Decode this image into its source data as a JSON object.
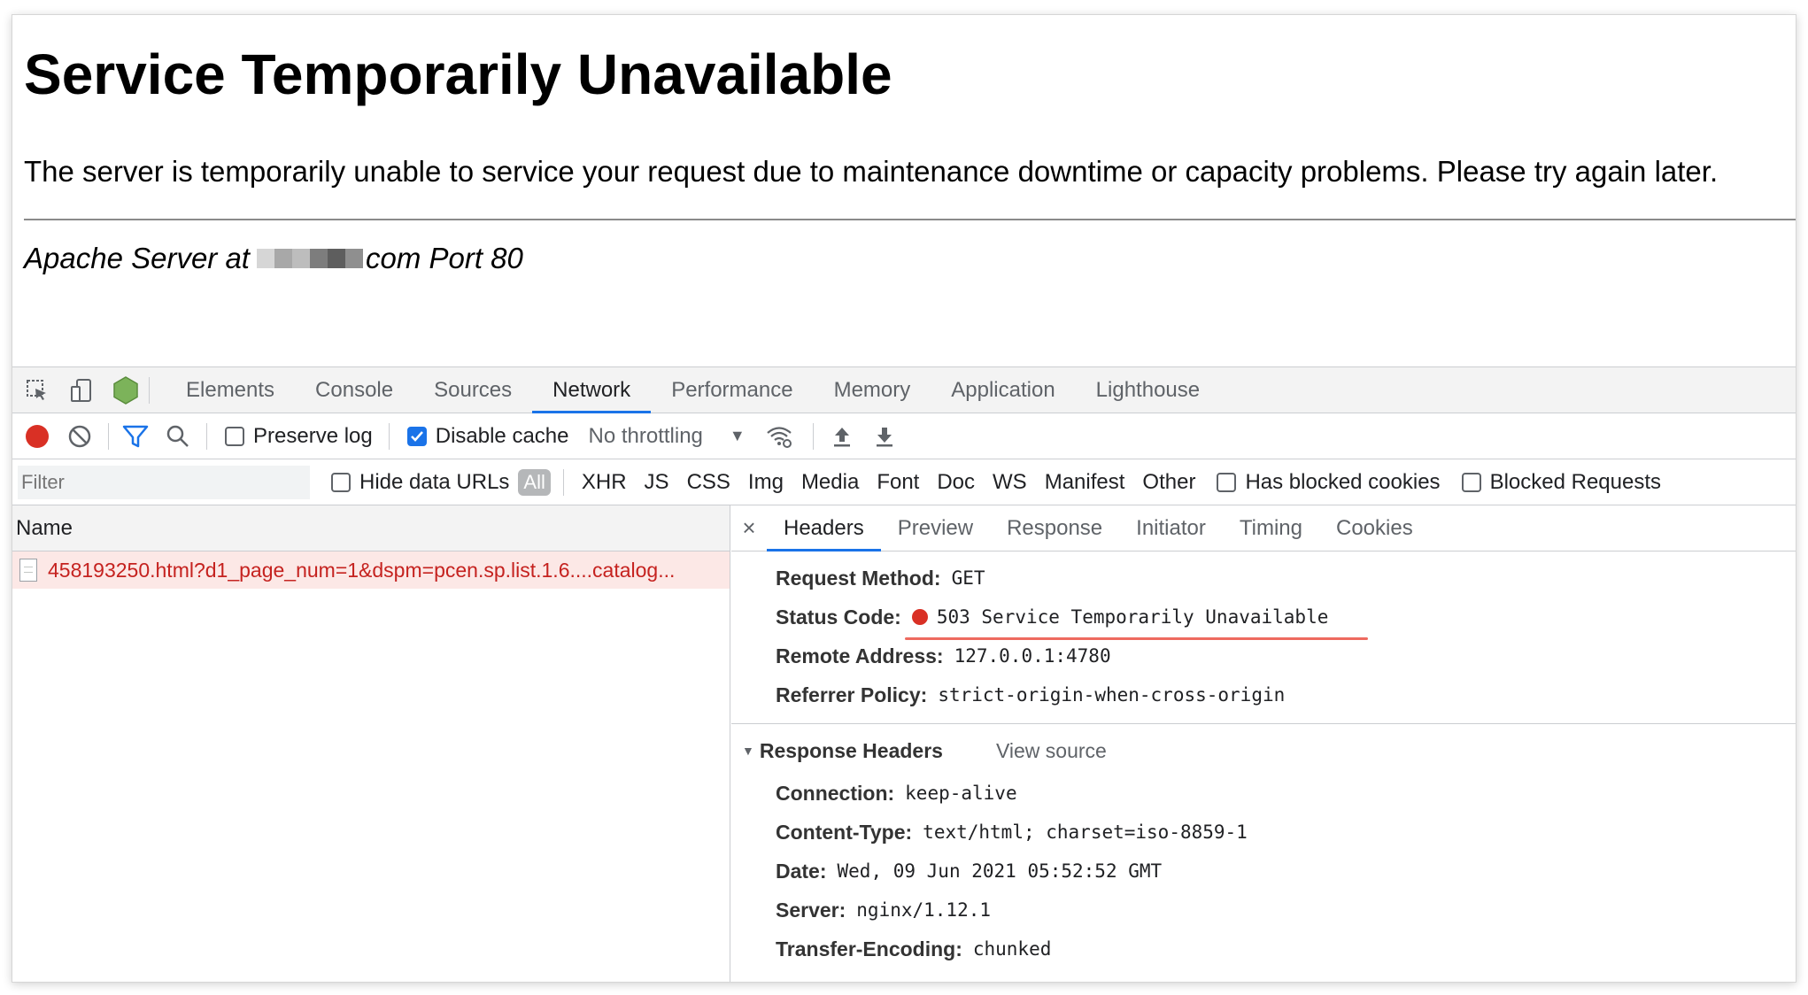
{
  "page": {
    "title": "Service Temporarily Unavailable",
    "message": "The server is temporarily unable to service your request due to maintenance downtime or capacity problems. Please try again later.",
    "signature_prefix": "Apache Server at",
    "signature_suffix": "com Port 80"
  },
  "devtools": {
    "tabs": [
      "Elements",
      "Console",
      "Sources",
      "Network",
      "Performance",
      "Memory",
      "Application",
      "Lighthouse"
    ],
    "active_tab": "Network",
    "toolbar": {
      "preserve_log": "Preserve log",
      "disable_cache": "Disable cache",
      "throttling": "No throttling"
    },
    "filter": {
      "placeholder": "Filter",
      "hide_data_urls": "Hide data URLs",
      "all": "All",
      "types": [
        "XHR",
        "JS",
        "CSS",
        "Img",
        "Media",
        "Font",
        "Doc",
        "WS",
        "Manifest",
        "Other"
      ],
      "has_blocked_cookies": "Has blocked cookies",
      "blocked_requests": "Blocked Requests"
    },
    "list": {
      "column_name": "Name",
      "request": "458193250.html?d1_page_num=1&dspm=pcen.sp.list.1.6....catalog..."
    },
    "details": {
      "close": "×",
      "tabs": [
        "Headers",
        "Preview",
        "Response",
        "Initiator",
        "Timing",
        "Cookies"
      ],
      "active_tab": "Headers",
      "general": [
        {
          "key": "Request Method:",
          "value": "GET"
        },
        {
          "key": "Status Code:",
          "value": "503 Service Temporarily Unavailable"
        },
        {
          "key": "Remote Address:",
          "value": "127.0.0.1:4780"
        },
        {
          "key": "Referrer Policy:",
          "value": "strict-origin-when-cross-origin"
        }
      ],
      "response_headers_title": "Response Headers",
      "view_source": "View source",
      "response_headers": [
        {
          "key": "Connection:",
          "value": "keep-alive"
        },
        {
          "key": "Content-Type:",
          "value": "text/html; charset=iso-8859-1"
        },
        {
          "key": "Date:",
          "value": "Wed, 09 Jun 2021 05:52:52 GMT"
        },
        {
          "key": "Server:",
          "value": "nginx/1.12.1"
        },
        {
          "key": "Transfer-Encoding:",
          "value": "chunked"
        }
      ]
    }
  },
  "colors": {
    "accent": "#1a73e8",
    "error": "#d93025",
    "error_row_bg": "#fce8e6",
    "annotation": "#ee6a5f"
  }
}
